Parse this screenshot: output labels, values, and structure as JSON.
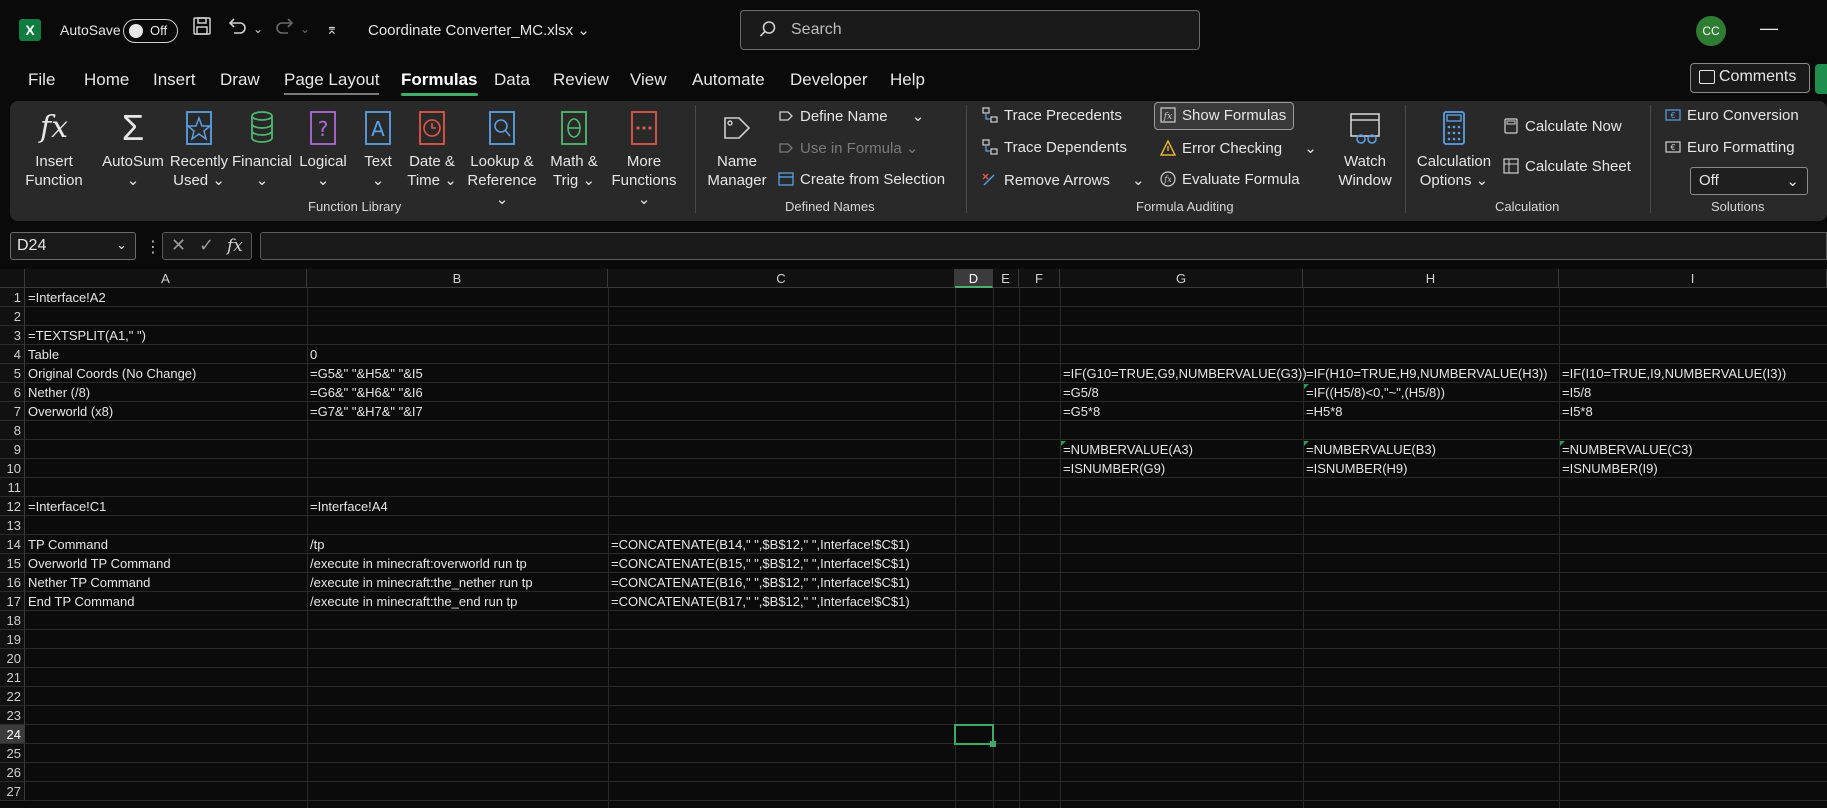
{
  "titlebar": {
    "app_icon": "X",
    "autosave_label": "AutoSave",
    "autosave_state": "Off",
    "file_name": "Coordinate Converter_MC.xlsx",
    "search_placeholder": "Search",
    "avatar_initials": "CC"
  },
  "menu": {
    "tabs": [
      "File",
      "Home",
      "Insert",
      "Draw",
      "Page Layout",
      "Formulas",
      "Data",
      "Review",
      "View",
      "Automate",
      "Developer",
      "Help"
    ],
    "active_tab": "Formulas",
    "comments_label": "Comments"
  },
  "ribbon": {
    "function_library": {
      "label": "Function Library",
      "insert_function": [
        "Insert",
        "Function"
      ],
      "autosum": "AutoSum",
      "recently_used": [
        "Recently",
        "Used"
      ],
      "financial": "Financial",
      "logical": "Logical",
      "text": "Text",
      "date_time": [
        "Date &",
        "Time"
      ],
      "lookup_reference": [
        "Lookup &",
        "Reference"
      ],
      "math_trig": [
        "Math &",
        "Trig"
      ],
      "more_functions": [
        "More",
        "Functions"
      ]
    },
    "defined_names": {
      "label": "Defined Names",
      "name_manager": [
        "Name",
        "Manager"
      ],
      "define_name": "Define Name",
      "use_in_formula": "Use in Formula",
      "create_from_selection": "Create from Selection"
    },
    "formula_auditing": {
      "label": "Formula Auditing",
      "trace_precedents": "Trace Precedents",
      "trace_dependents": "Trace Dependents",
      "remove_arrows": "Remove Arrows",
      "show_formulas": "Show Formulas",
      "error_checking": "Error Checking",
      "evaluate_formula": "Evaluate Formula",
      "watch_window": [
        "Watch",
        "Window"
      ]
    },
    "calculation": {
      "label": "Calculation",
      "calculation_options": [
        "Calculation",
        "Options"
      ],
      "calculate_now": "Calculate Now",
      "calculate_sheet": "Calculate Sheet"
    },
    "solutions": {
      "label": "Solutions",
      "euro_conversion": "Euro Conversion",
      "euro_formatting": "Euro Formatting",
      "euro_select_value": "Off"
    }
  },
  "formula_bar": {
    "name_box": "D24",
    "formula": ""
  },
  "grid": {
    "columns": [
      "A",
      "B",
      "C",
      "D",
      "E",
      "F",
      "G",
      "H",
      "I"
    ],
    "selected_column": "D",
    "rows": [
      "1",
      "2",
      "3",
      "4",
      "5",
      "6",
      "7",
      "8",
      "9",
      "10",
      "11",
      "12",
      "13",
      "14",
      "15",
      "16",
      "17",
      "18",
      "19",
      "20",
      "21",
      "22",
      "23",
      "24",
      "25",
      "26",
      "27"
    ],
    "selected_row": "24",
    "cells": {
      "A1": "=Interface!A2",
      "A3": "=TEXTSPLIT(A1,\" \")",
      "A4": "Table",
      "B4": "0",
      "A5": "Original Coords (No Change)",
      "B5": "=G5&\" \"&H5&\" \"&I5",
      "G5": "=IF(G10=TRUE,G9,NUMBERVALUE(G3))",
      "H5": "=IF(H10=TRUE,H9,NUMBERVALUE(H3))",
      "I5": "=IF(I10=TRUE,I9,NUMBERVALUE(I3))",
      "A6": "Nether (/8)",
      "B6": "=G6&\" \"&H6&\" \"&I6",
      "G6": "=G5/8",
      "H6": "=IF((H5/8)<0,\"~\",(H5/8))",
      "I6": "=I5/8",
      "A7": "Overworld (x8)",
      "B7": "=G7&\" \"&H7&\" \"&I7",
      "G7": "=G5*8",
      "H7": "=H5*8",
      "I7": "=I5*8",
      "G9": "=NUMBERVALUE(A3)",
      "H9": "=NUMBERVALUE(B3)",
      "I9": "=NUMBERVALUE(C3)",
      "G10": "=ISNUMBER(G9)",
      "H10": "=ISNUMBER(H9)",
      "I10": "=ISNUMBER(I9)",
      "A12": "=Interface!C1",
      "B12": "=Interface!A4",
      "A14": "TP Command",
      "B14": "/tp",
      "C14": "=CONCATENATE(B14,\" \",$B$12,\" \",Interface!$C$1)",
      "A15": "Overworld TP Command",
      "B15": "/execute in minecraft:overworld run tp",
      "C15": "=CONCATENATE(B15,\" \",$B$12,\" \",Interface!$C$1)",
      "A16": "Nether TP Command",
      "B16": "/execute in minecraft:the_nether run tp",
      "C16": "=CONCATENATE(B16,\" \",$B$12,\" \",Interface!$C$1)",
      "A17": "End TP Command",
      "B17": "/execute in minecraft:the_end run tp",
      "C17": "=CONCATENATE(B17,\" \",$B$12,\" \",Interface!$C$1)"
    }
  },
  "colors": {
    "accent": "#3fb06a",
    "app_green": "#107c41",
    "background": "#0a0a0a",
    "ribbon": "#292929"
  }
}
